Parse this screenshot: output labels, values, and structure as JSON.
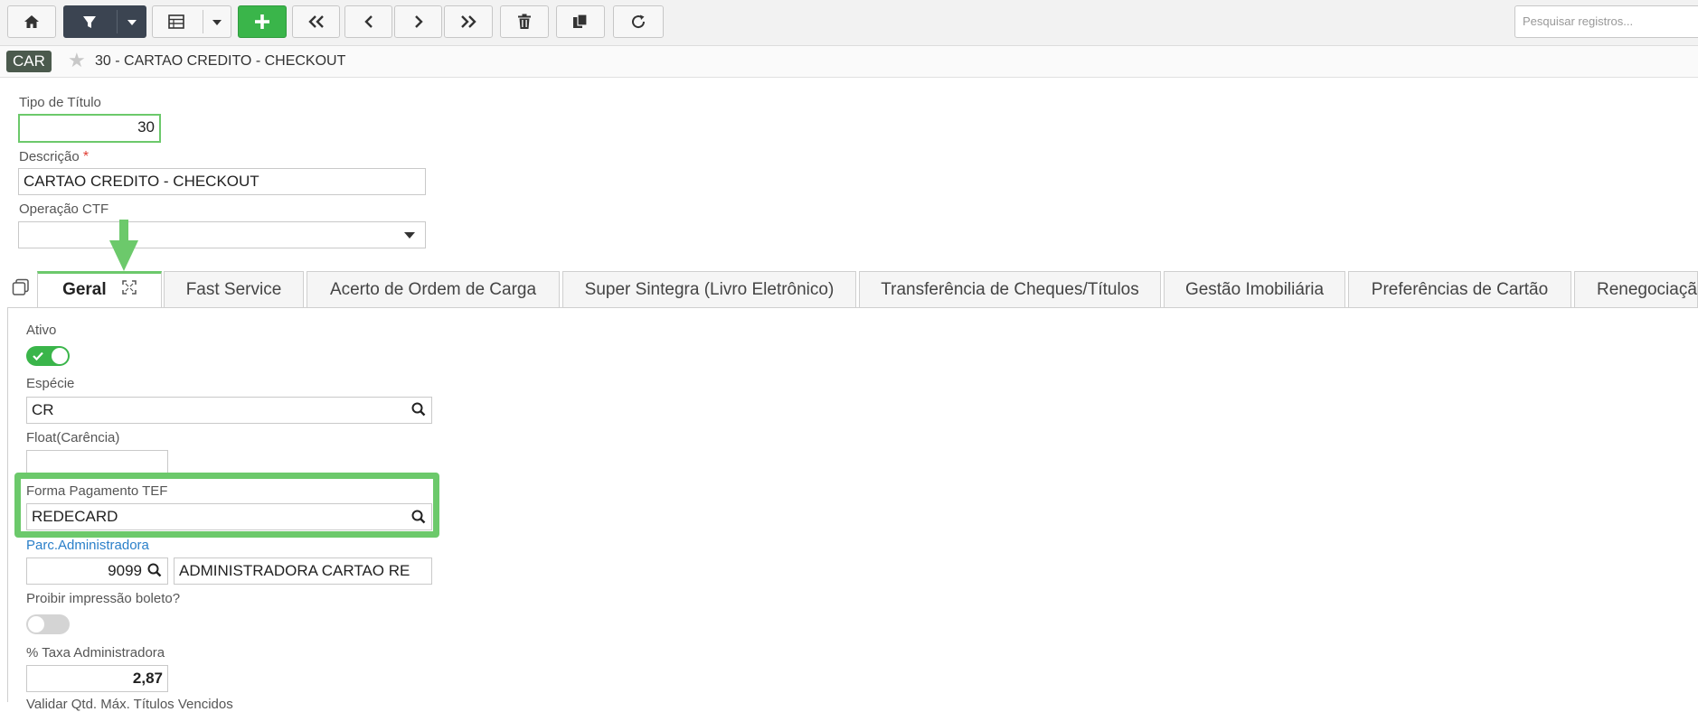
{
  "toolbar": {
    "search_placeholder": "Pesquisar registros..."
  },
  "breadcrumb": {
    "module_badge": "CAR",
    "title": "30 - CARTAO CREDITO - CHECKOUT"
  },
  "header_form": {
    "tipo_titulo_label": "Tipo de Título",
    "tipo_titulo_value": "30",
    "descricao_label": "Descrição",
    "descricao_required": "*",
    "descricao_value": "CARTAO CREDITO  - CHECKOUT",
    "operacao_ctf_label": "Operação CTF",
    "operacao_ctf_value": ""
  },
  "tabs": [
    {
      "label": "Geral"
    },
    {
      "label": "Fast Service"
    },
    {
      "label": "Acerto de Ordem de Carga"
    },
    {
      "label": "Super Sintegra (Livro Eletrônico)"
    },
    {
      "label": "Transferência de Cheques/Títulos"
    },
    {
      "label": "Gestão Imobiliária"
    },
    {
      "label": "Preferências de Cartão"
    },
    {
      "label": "Renegociação"
    }
  ],
  "geral": {
    "ativo_label": "Ativo",
    "ativo_on": true,
    "especie_label": "Espécie",
    "especie_value": "CR",
    "float_label": "Float(Carência)",
    "float_value": "",
    "forma_pagamento_label": "Forma Pagamento TEF",
    "forma_pagamento_value": "REDECARD",
    "parc_admin_label": "Parc.Administradora",
    "parc_admin_code": "9099",
    "parc_admin_name": "ADMINISTRADORA CARTAO  RE",
    "proibir_label": "Proibir impressão boleto?",
    "proibir_on": false,
    "taxa_label": "% Taxa Administradora",
    "taxa_value": "2,87",
    "validar_label": "Validar Qtd. Máx. Títulos Vencidos"
  },
  "colors": {
    "accent_green": "#6cc96b",
    "add_button": "#3ab54a",
    "filter_button": "#3b4451"
  }
}
